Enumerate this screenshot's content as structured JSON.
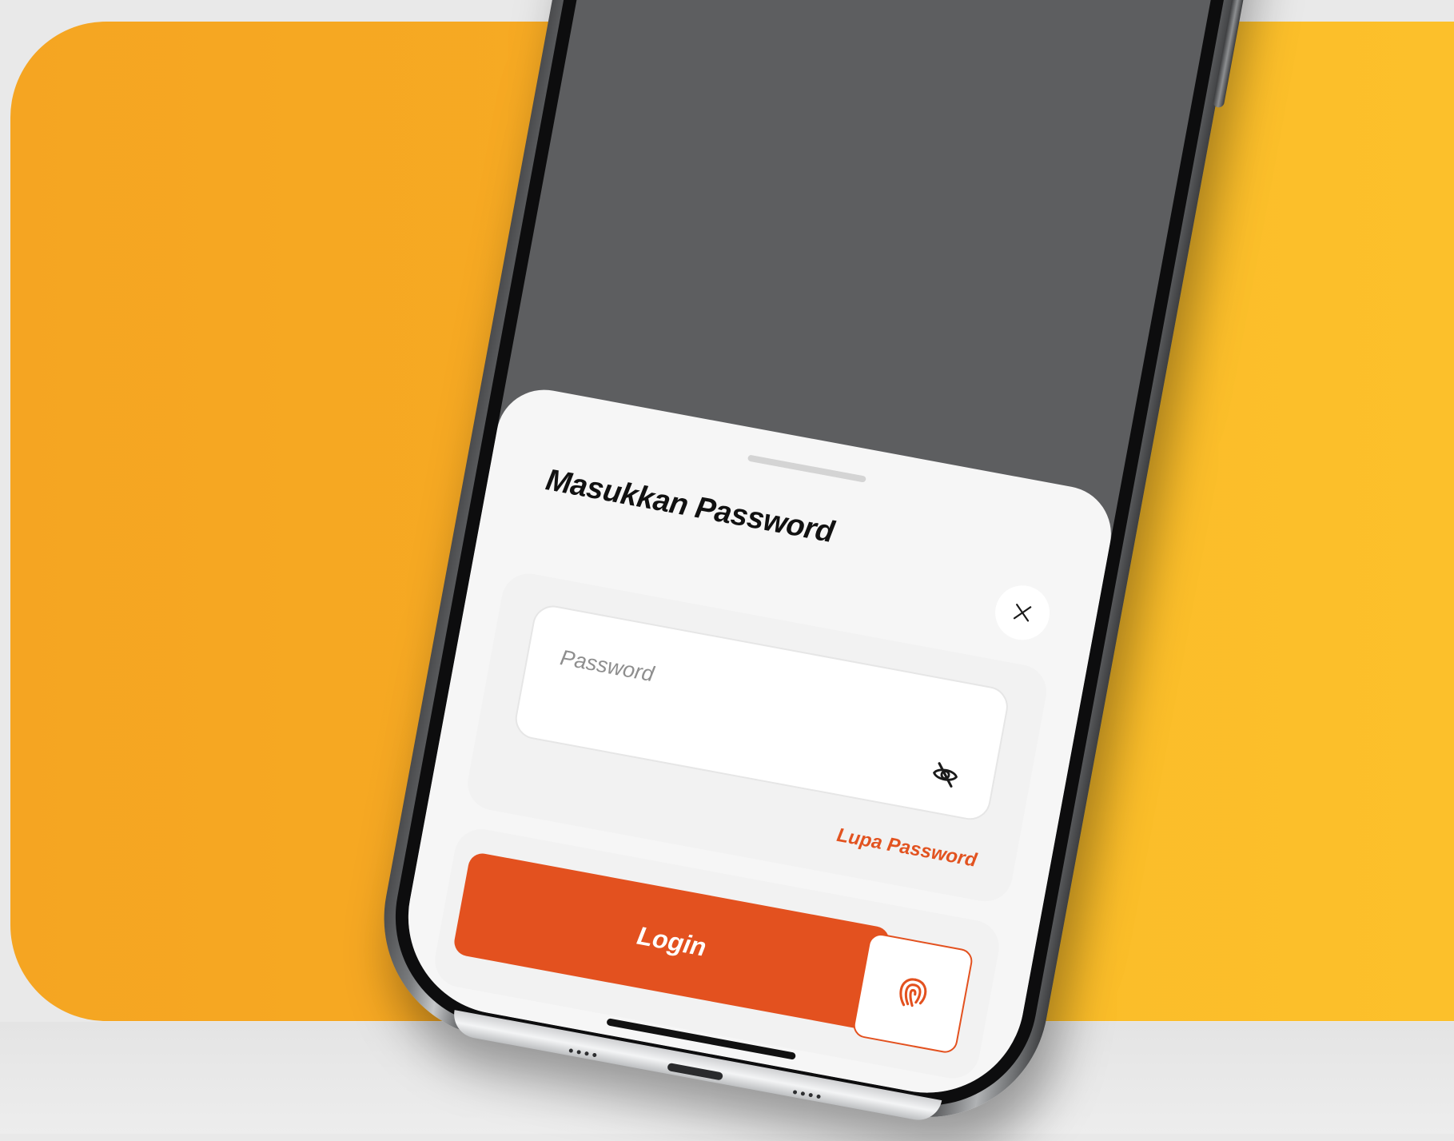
{
  "sheet": {
    "title": "Masukkan Password",
    "close_icon": "close-icon"
  },
  "password": {
    "placeholder": "Password",
    "value": "",
    "visibility_icon": "eye-off-icon"
  },
  "forgot_password": {
    "label": "Lupa Password"
  },
  "actions": {
    "login_label": "Login",
    "biometric_icon": "fingerprint-icon"
  },
  "colors": {
    "accent": "#e3511f",
    "background_orange": "#f5a522",
    "background_yellow": "#fcc02b",
    "phone_screen": "#5d5e60",
    "sheet": "#f6f6f6"
  }
}
